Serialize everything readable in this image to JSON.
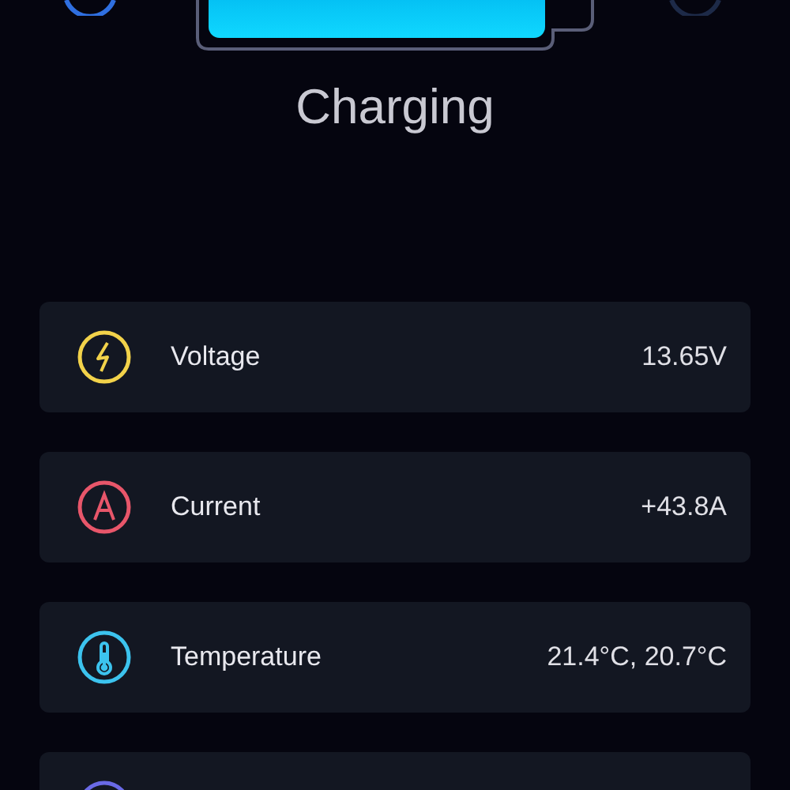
{
  "status": "Charging",
  "metrics": [
    {
      "kind": "voltage",
      "label": "Voltage",
      "value": "13.65V",
      "color": "#f2d24a"
    },
    {
      "kind": "current",
      "label": "Current",
      "value": "+43.8A",
      "color": "#e8566a"
    },
    {
      "kind": "temperature",
      "label": "Temperature",
      "value": "21.4°C, 20.7°C",
      "color": "#3cc3ee"
    },
    {
      "kind": "other",
      "color": "#6a6ae6"
    }
  ]
}
